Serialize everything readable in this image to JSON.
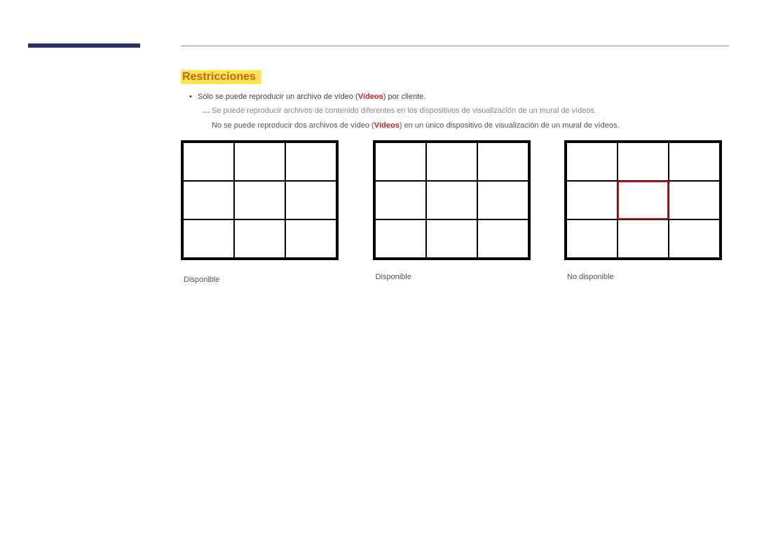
{
  "section": {
    "title": "Restricciones"
  },
  "bullets": {
    "main": "Sólo se puede reproducir un archivo de vídeo (",
    "main_em": "Vídeos",
    "main_tail": ") por cliente.",
    "sub1": "Se puede reproducir archivos de contenido diferentes en los dispositivos de visualización de un mural de vídeos.",
    "sub2_pre": "No se puede reproducir dos archivos de vídeo (",
    "sub2_em": "Vídeos",
    "sub2_post": ") en un único dispositivo de visualización de un mural de vídeos."
  },
  "grids": {
    "caption1": "Disponible",
    "caption2": "Disponible",
    "caption3": "No disponible"
  }
}
